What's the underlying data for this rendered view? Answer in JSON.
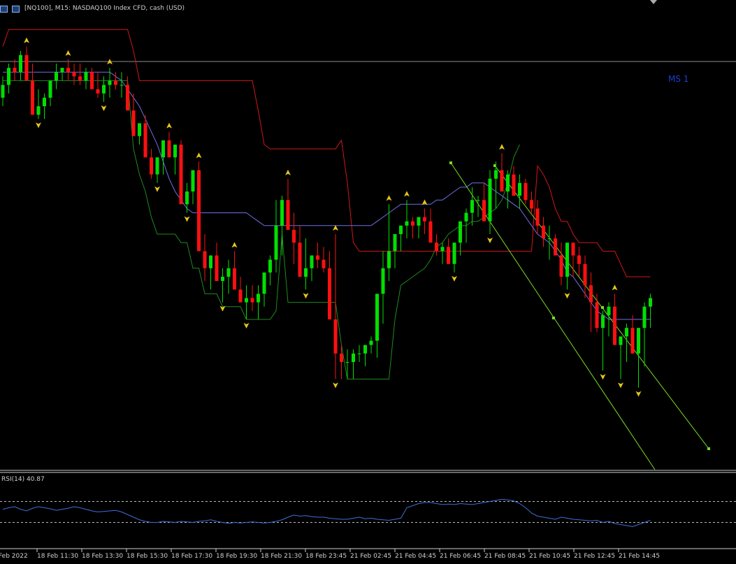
{
  "header": {
    "title": "[NQ100], M15:  NASDAQ100 Index CFD, cash (USD)",
    "icons": [
      "chart-window-icon",
      "chart-type-icon"
    ]
  },
  "colors": {
    "background": "#000000",
    "bull_candle": "#00e000",
    "bear_candle": "#ff1010",
    "upper_band": "#d01818",
    "lower_band": "#1f8a1f",
    "mid_line": "#6f6fe6",
    "channel": "#77dd22",
    "arrow": "#e6c61a",
    "rsi_line": "#3f6fd8",
    "hline": "#8c8c8c"
  },
  "chart_data": [
    {
      "type": "candlestick",
      "title": "[NQ100], M15:  NASDAQ100 Index CFD, cash (USD)",
      "horizontal_line_label": "MS 1",
      "x_tick_labels": [
        "Feb 2022",
        "18 Feb 11:30",
        "18 Feb 13:30",
        "18 Feb 15:30",
        "18 Feb 17:30",
        "18 Feb 19:30",
        "18 Feb 21:30",
        "18 Feb 23:45",
        "21 Feb 02:45",
        "21 Feb 04:45",
        "21 Feb 06:45",
        "21 Feb 08:45",
        "21 Feb 10:45",
        "21 Feb 12:45",
        "21 Feb 14:45"
      ],
      "price_range": [
        0,
        100
      ],
      "hline_level": 90.5,
      "candles": {
        "open": [
          82,
          85,
          89,
          88,
          92,
          86,
          78,
          80,
          82,
          86,
          88,
          89,
          88,
          87,
          86,
          88,
          84,
          83,
          85,
          86,
          85,
          85,
          79,
          73,
          76,
          68,
          64,
          68,
          72,
          68,
          71,
          57,
          60,
          65,
          46,
          42,
          45,
          39,
          40,
          42,
          37,
          34,
          35,
          34,
          36,
          41,
          44,
          52,
          58,
          51,
          48,
          40,
          42,
          45,
          44,
          42,
          30,
          22,
          20,
          20,
          22,
          22,
          24,
          25,
          36,
          42,
          46,
          50,
          52,
          53,
          52,
          54,
          53,
          48,
          46,
          47,
          43,
          48,
          53,
          55,
          58,
          58,
          53,
          63,
          65,
          60,
          64,
          59,
          62,
          58,
          56,
          52,
          49,
          49,
          45,
          40,
          48,
          45,
          43,
          38,
          34,
          28,
          31,
          33,
          24,
          26,
          28,
          22,
          28,
          33
        ],
        "high": [
          87,
          90,
          91,
          93,
          94,
          90,
          84,
          83,
          86,
          90,
          89,
          91,
          90,
          90,
          89,
          89,
          88,
          87,
          89,
          88,
          88,
          87,
          83,
          76,
          78,
          70,
          68,
          71,
          74,
          70,
          72,
          62,
          62,
          67,
          50,
          45,
          48,
          42,
          44,
          46,
          40,
          38,
          38,
          38,
          39,
          45,
          58,
          59,
          63,
          55,
          52,
          49,
          45,
          48,
          47,
          46,
          50,
          24,
          23,
          23,
          24,
          24,
          26,
          31,
          46,
          57,
          49,
          52,
          58,
          54,
          54,
          56,
          56,
          50,
          48,
          49,
          48,
          51,
          56,
          61,
          59,
          62,
          65,
          67,
          69,
          65,
          66,
          64,
          63,
          60,
          58,
          54,
          52,
          50,
          48,
          46,
          48,
          47,
          45,
          41,
          36,
          32,
          34,
          36,
          26,
          29,
          31,
          26,
          34,
          36
        ],
        "low": [
          80,
          83,
          86,
          86,
          89,
          82,
          77,
          77,
          80,
          84,
          86,
          86,
          85,
          85,
          84,
          84,
          82,
          81,
          82,
          84,
          82,
          83,
          77,
          71,
          73,
          63,
          62,
          64,
          68,
          64,
          66,
          55,
          57,
          62,
          39,
          37,
          41,
          34,
          36,
          39,
          34,
          30,
          32,
          30,
          33,
          38,
          41,
          45,
          51,
          43,
          43,
          37,
          39,
          42,
          41,
          32,
          16,
          16,
          16,
          16,
          20,
          19,
          22,
          21,
          29,
          39,
          42,
          46,
          49,
          49,
          49,
          50,
          49,
          45,
          43,
          43,
          41,
          45,
          48,
          52,
          54,
          56,
          50,
          56,
          60,
          56,
          59,
          56,
          57,
          55,
          50,
          47,
          44,
          45,
          38,
          37,
          40,
          40,
          35,
          27,
          27,
          18,
          26,
          27,
          16,
          20,
          24,
          14,
          19,
          28
        ],
        "close": [
          85,
          89,
          88,
          92,
          86,
          78,
          80,
          82,
          86,
          88,
          89,
          88,
          87,
          86,
          88,
          84,
          83,
          85,
          86,
          85,
          85,
          79,
          73,
          76,
          68,
          64,
          68,
          72,
          68,
          71,
          57,
          60,
          65,
          46,
          42,
          45,
          39,
          40,
          42,
          37,
          34,
          35,
          34,
          36,
          41,
          44,
          52,
          58,
          51,
          48,
          40,
          42,
          45,
          44,
          42,
          30,
          22,
          20,
          20,
          22,
          22,
          24,
          25,
          36,
          42,
          46,
          50,
          52,
          53,
          52,
          54,
          53,
          48,
          46,
          47,
          43,
          48,
          53,
          55,
          58,
          58,
          53,
          63,
          65,
          60,
          64,
          59,
          62,
          58,
          56,
          52,
          49,
          49,
          45,
          40,
          48,
          45,
          43,
          38,
          34,
          28,
          31,
          33,
          24,
          26,
          28,
          22,
          28,
          33,
          35
        ]
      },
      "upper_band": [
        94,
        98,
        98,
        98,
        98,
        98,
        98,
        98,
        98,
        98,
        98,
        98,
        98,
        98,
        98,
        98,
        98,
        98,
        98,
        98,
        98,
        98,
        93,
        86,
        86,
        86,
        86,
        86,
        86,
        86,
        86,
        86,
        86,
        86,
        86,
        86,
        86,
        86,
        86,
        86,
        86,
        86,
        86,
        79,
        71,
        70,
        70,
        70,
        70,
        70,
        70,
        70,
        70,
        70,
        70,
        70,
        70,
        72,
        62,
        48,
        46,
        46,
        46,
        46,
        46,
        46,
        46,
        46,
        46,
        46,
        46,
        46,
        46,
        46,
        46,
        46,
        46,
        46,
        46,
        46,
        46,
        46,
        46,
        46,
        46,
        46,
        46,
        46,
        46,
        46,
        66,
        64,
        61,
        56,
        53,
        53,
        50,
        48,
        48,
        48,
        48,
        46,
        46,
        46,
        43,
        40,
        40,
        40,
        40,
        40
      ],
      "lower_band": [
        86,
        86,
        86,
        86,
        86,
        86,
        86,
        86,
        86,
        86,
        86,
        86,
        86,
        86,
        86,
        86,
        86,
        86,
        86,
        86,
        86,
        86,
        70,
        64,
        60,
        54,
        50,
        50,
        50,
        50,
        48,
        48,
        42,
        42,
        36,
        36,
        36,
        33,
        33,
        33,
        33,
        30,
        30,
        30,
        30,
        30,
        32,
        50,
        34,
        34,
        34,
        34,
        34,
        34,
        34,
        34,
        34,
        24,
        16,
        16,
        16,
        16,
        16,
        16,
        16,
        16,
        30,
        38,
        39,
        40,
        41,
        42,
        44,
        47,
        48,
        50,
        51,
        52,
        52,
        53,
        53,
        54,
        55,
        56,
        58,
        62,
        68,
        71
      ],
      "mid_line": [
        88,
        88,
        88,
        88,
        88,
        88,
        88,
        88,
        88,
        88,
        88,
        88,
        88,
        88,
        88,
        88,
        88,
        88,
        88,
        87,
        86,
        84,
        82,
        80,
        77,
        74,
        71,
        67,
        63,
        60,
        58,
        56,
        55,
        55,
        55,
        55,
        55,
        55,
        55,
        55,
        55,
        55,
        54,
        53,
        52,
        52,
        52,
        52,
        52,
        52,
        52,
        52,
        52,
        52,
        52,
        52,
        52,
        52,
        52,
        52,
        52,
        52,
        52,
        53,
        54,
        55,
        56,
        57,
        57,
        57,
        57,
        57,
        57,
        58,
        58,
        59,
        60,
        61,
        61,
        62,
        62,
        62,
        61,
        60,
        59,
        58,
        57,
        56,
        54,
        52,
        50,
        49,
        48,
        46,
        44,
        41,
        40,
        38,
        36,
        34,
        32,
        31,
        30,
        30,
        30,
        30,
        30,
        30,
        30,
        30
      ]
    },
    {
      "type": "line",
      "name": "RSI(14) 40.87",
      "label": "RSI(14) 40.87",
      "ylim": [
        0,
        100
      ],
      "levels": [
        70,
        30
      ],
      "values": [
        55,
        58,
        60,
        55,
        52,
        57,
        60,
        58,
        56,
        53,
        55,
        57,
        60,
        58,
        55,
        52,
        50,
        51,
        52,
        53,
        50,
        45,
        40,
        35,
        32,
        30,
        30,
        32,
        31,
        30,
        32,
        31,
        30,
        32,
        33,
        35,
        32,
        30,
        28,
        30,
        29,
        30,
        31,
        30,
        29,
        30,
        32,
        35,
        40,
        44,
        42,
        43,
        41,
        40,
        40,
        38,
        37,
        36,
        36,
        38,
        40,
        37,
        38,
        36,
        35,
        34,
        36,
        38,
        58,
        62,
        66,
        68,
        68,
        66,
        64,
        65,
        64,
        66,
        65,
        64,
        66,
        68,
        70,
        72,
        74,
        73,
        71,
        66,
        58,
        48,
        42,
        40,
        38,
        36,
        40,
        38,
        36,
        35,
        34,
        33,
        34,
        30,
        32,
        28,
        26,
        24,
        22,
        26,
        30,
        34
      ]
    }
  ]
}
